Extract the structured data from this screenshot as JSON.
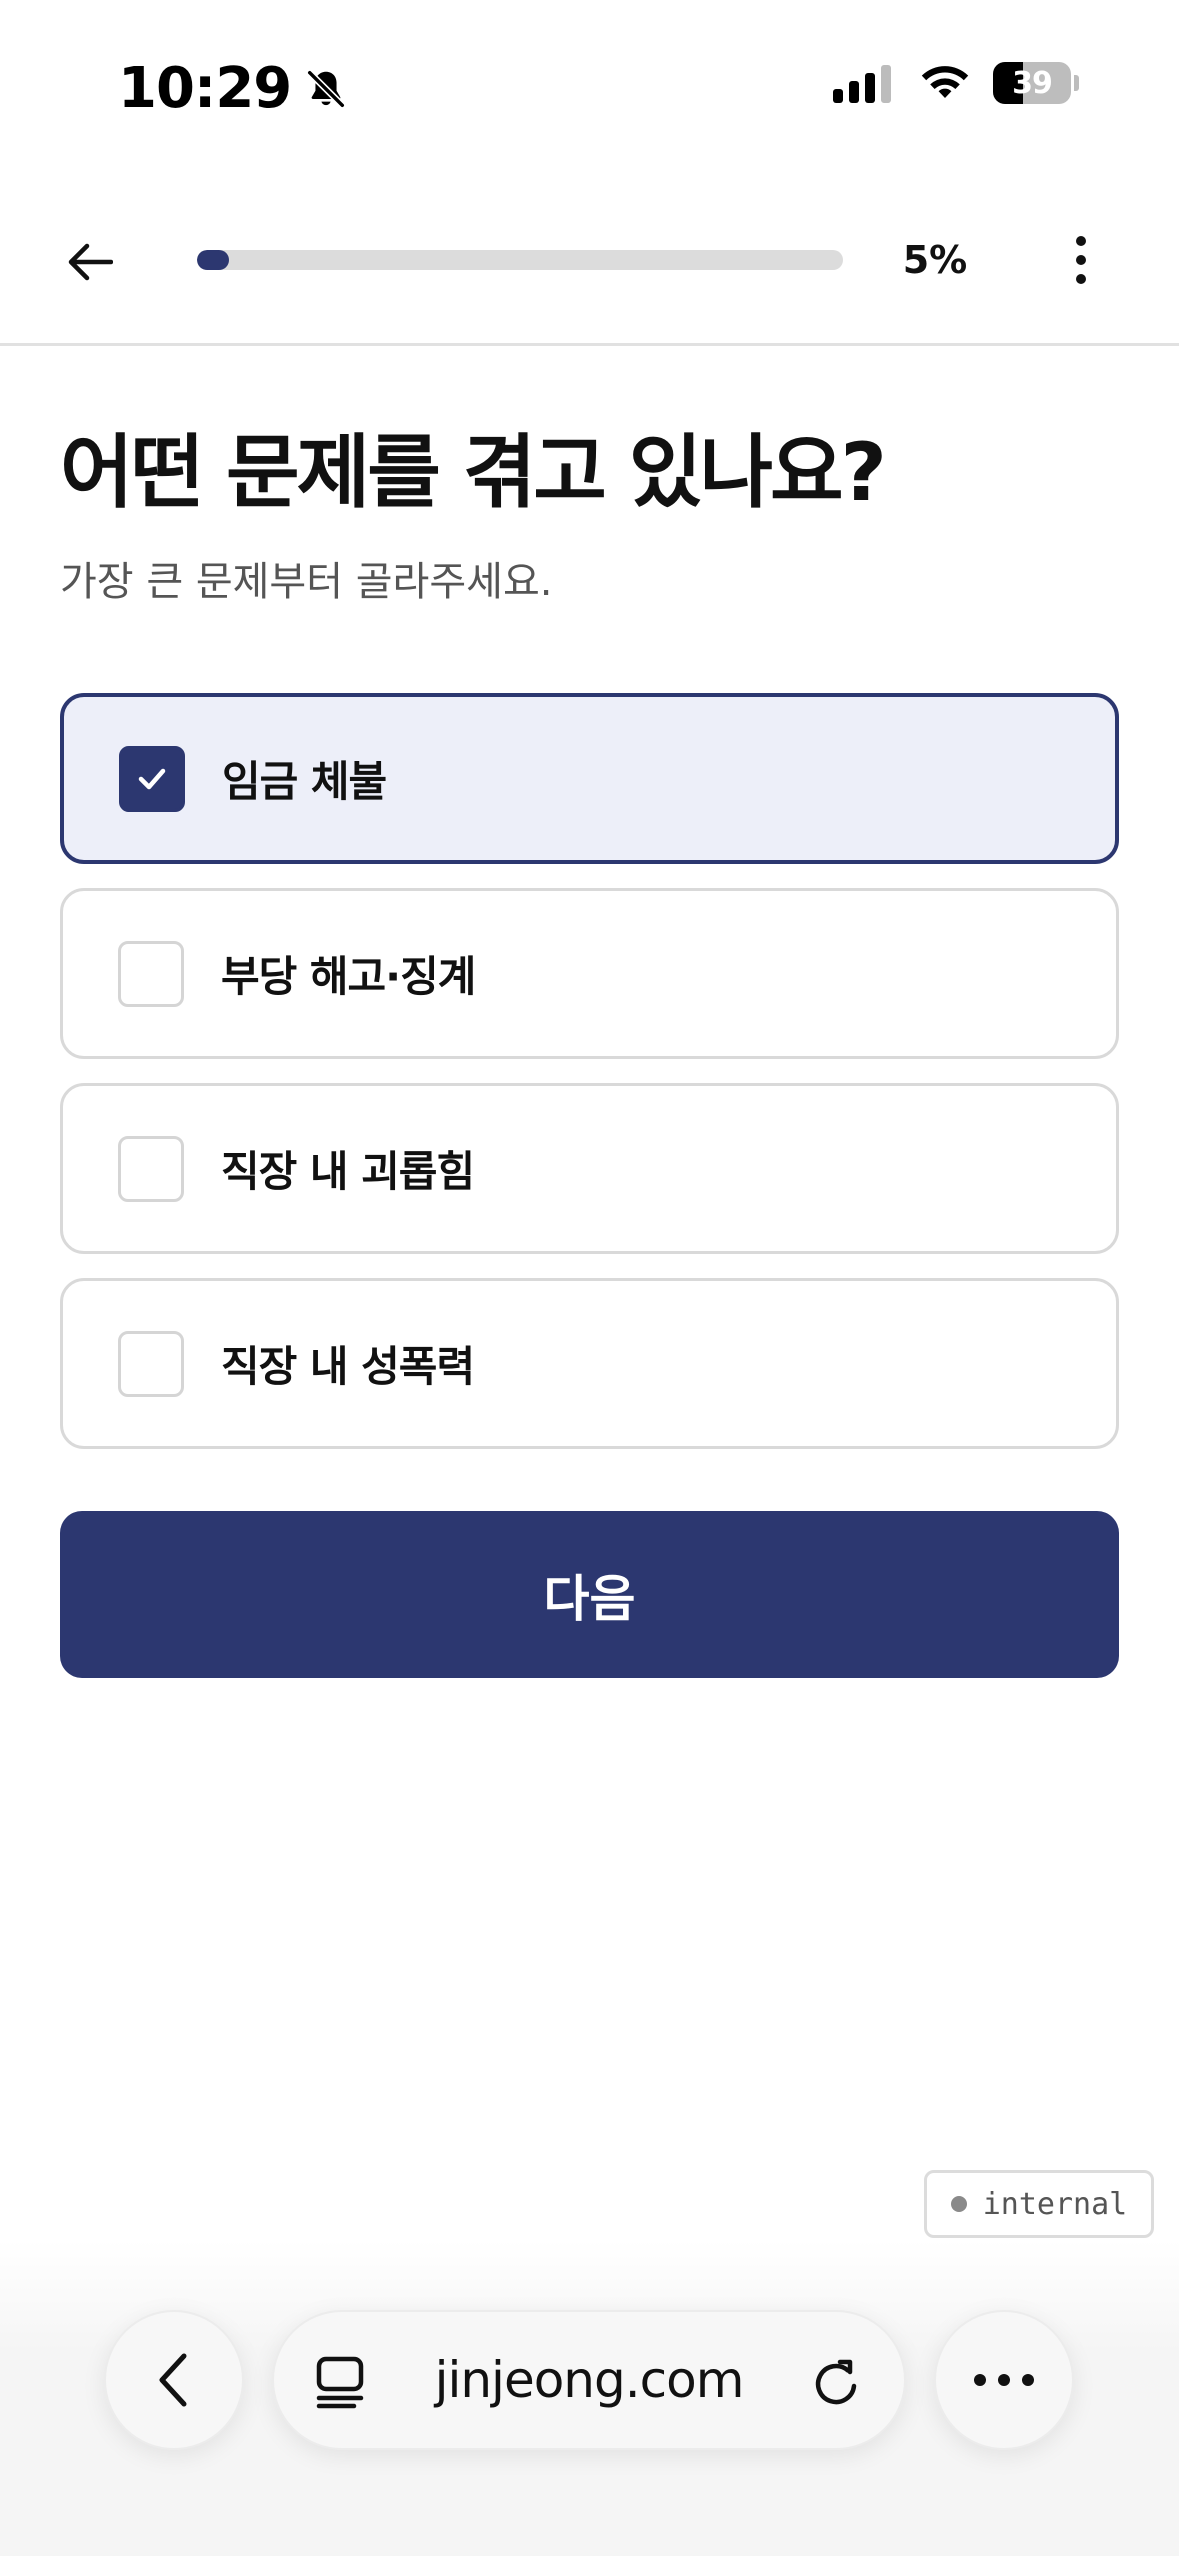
{
  "status_bar": {
    "time": "10:29",
    "battery_level": "39",
    "battery_fraction": 0.39
  },
  "header": {
    "progress_label": "5%",
    "progress_fraction": 0.05
  },
  "main": {
    "title": "어떤 문제를 겪고 있나요?",
    "subtitle": "가장 큰 문제부터 골라주세요.",
    "options": [
      {
        "label": "임금 체불",
        "selected": true
      },
      {
        "label": "부당 해고·징계",
        "selected": false
      },
      {
        "label": "직장 내 괴롭힘",
        "selected": false
      },
      {
        "label": "직장 내 성폭력",
        "selected": false
      }
    ],
    "next_label": "다음"
  },
  "badge": {
    "label": "internal"
  },
  "browser": {
    "url": "jinjeong.com"
  },
  "colors": {
    "accent": "#2c3770",
    "selected_background": "#edeff9",
    "border": "#d9d9d9"
  },
  "icons": [
    "muted-bell-icon",
    "cellular-signal-icon",
    "wifi-icon",
    "battery-icon",
    "back-arrow-icon",
    "more-vertical-icon",
    "checkmark-icon",
    "chevron-left-icon",
    "tabs-icon",
    "reload-icon",
    "more-horizontal-icon"
  ]
}
